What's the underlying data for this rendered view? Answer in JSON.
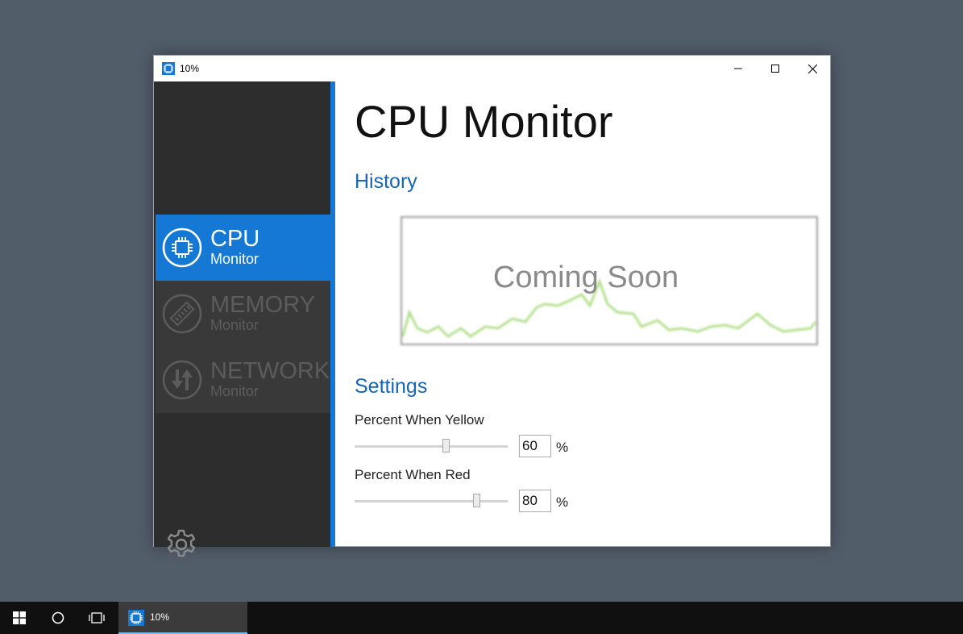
{
  "window": {
    "title": "10%",
    "controls": [
      "minimize-icon",
      "maximize-icon",
      "close-icon"
    ]
  },
  "sidebar": {
    "items": [
      {
        "title": "CPU",
        "subtitle": "Monitor",
        "icon": "cpu-chip-icon",
        "active": true
      },
      {
        "title": "MEMORY",
        "subtitle": "Monitor",
        "icon": "memory-stick-icon",
        "active": false
      },
      {
        "title": "NETWORK",
        "subtitle": "Monitor",
        "icon": "network-arrows-icon",
        "active": false
      }
    ],
    "settings_icon": "gear-icon"
  },
  "main": {
    "title": "CPU Monitor",
    "history": {
      "heading": "History",
      "overlay_text": "Coming Soon"
    },
    "settings": {
      "heading": "Settings",
      "yellow": {
        "label": "Percent When Yellow",
        "value": "60",
        "unit": "%",
        "slider_fraction": 0.6
      },
      "red": {
        "label": "Percent When Red",
        "value": "80",
        "unit": "%",
        "slider_fraction": 0.8
      }
    }
  },
  "taskbar": {
    "items": [
      "windows-start-icon",
      "cortana-circle-icon",
      "task-view-icon"
    ],
    "app_label": "10%"
  },
  "colors": {
    "accent": "#1478d4",
    "sidebar_bg": "#2d2d2d",
    "heading_blue": "#1566b7",
    "desktop": "#525d6a"
  }
}
